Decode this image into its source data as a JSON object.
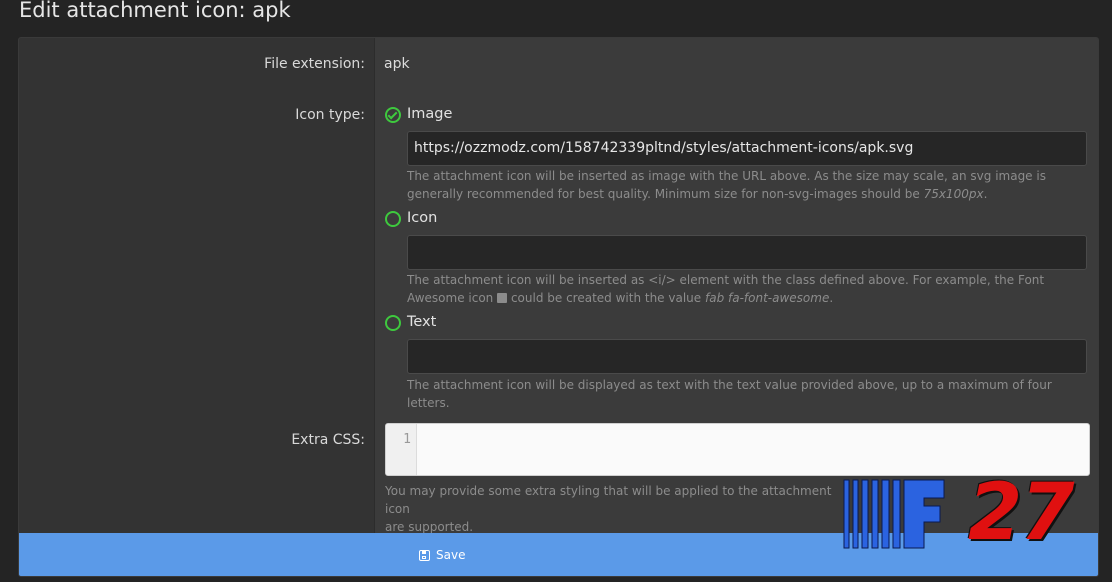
{
  "page": {
    "title": "Edit attachment icon: apk"
  },
  "form": {
    "file_extension": {
      "label": "File extension:",
      "value": "apk"
    },
    "icon_type": {
      "label": "Icon type:",
      "options": [
        {
          "label": "Image",
          "checked": true,
          "input_value": "https://ozzmodz.com/158742339pltnd/styles/attachment-icons/apk.svg",
          "hint": "The attachment icon will be inserted as image with the URL above. As the size may scale, an svg image is generally recommended for best quality. Minimum size for non-svg-images should be",
          "hint_em": "75x100px",
          "hint_end": "."
        },
        {
          "label": "Icon",
          "checked": false,
          "input_value": "",
          "hint": "The attachment icon will be inserted as <i/> element with the class defined above. For example, the Font Awesome icon",
          "hint_mid": "could be created with the value",
          "hint_em": "fab fa-font-awesome",
          "hint_end": "."
        },
        {
          "label": "Text",
          "checked": false,
          "input_value": "",
          "hint": "The attachment icon will be displayed as text with the text value provided above, up to a maximum of four letters."
        }
      ]
    },
    "extra_css": {
      "label": "Extra CSS:",
      "line_number": "1",
      "hint_line1": "You may provide some extra styling that will be applied to the attachment icon",
      "hint_line2": "are supported."
    }
  },
  "footer": {
    "save_label": "Save",
    "save_icon": "save-icon"
  },
  "watermark": {
    "text": "F27",
    "color_main": "#e01010",
    "color_stripes": "#2b63e0"
  },
  "colors": {
    "accent": "#5b9ae8",
    "radio": "#3ec93e"
  }
}
